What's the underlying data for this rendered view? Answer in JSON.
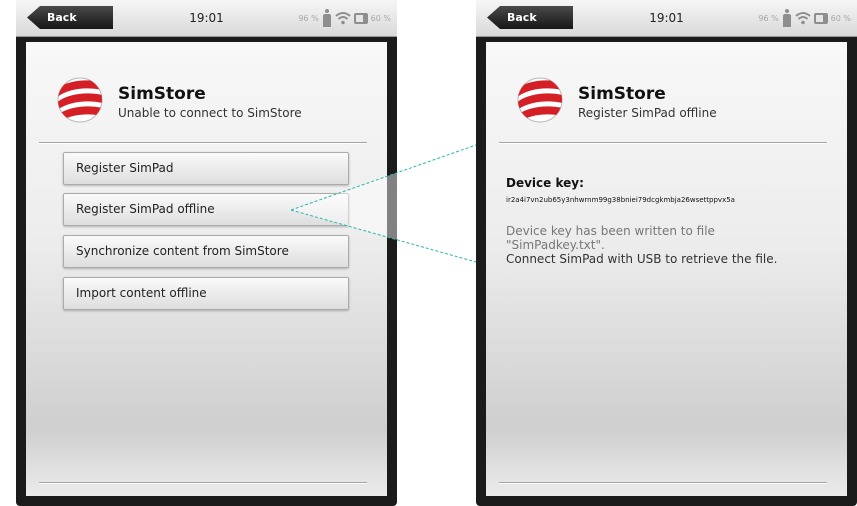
{
  "left_screen": {
    "status": {
      "back_label": "Back",
      "time": "19:01",
      "signal_percent": "96 %",
      "battery_percent": "60 %"
    },
    "header": {
      "title": "SimStore",
      "subtitle": "Unable to connect to SimStore"
    },
    "menu": [
      {
        "label": "Register SimPad"
      },
      {
        "label": "Register SimPad offline"
      },
      {
        "label": "Synchronize content from SimStore"
      },
      {
        "label": "Import content offline"
      }
    ]
  },
  "right_screen": {
    "status": {
      "back_label": "Back",
      "time": "19:01",
      "signal_percent": "96 %",
      "battery_percent": "60 %"
    },
    "header": {
      "title": "SimStore",
      "subtitle": "Register SimPad offline"
    },
    "device_key_label": "Device key:",
    "device_key_value": "ir2a4i7vn2ub65y3nhwrnm99g38bniei79dcgkmbja26wsettppvx5a",
    "info_line1": "Device key has been written to file",
    "info_line2": "\"SimPadkey.txt\".",
    "info_line3": "Connect SimPad with USB to retrieve the file."
  },
  "colors": {
    "logo_red": "#d41f26",
    "callout_line": "#2bb5b0"
  }
}
